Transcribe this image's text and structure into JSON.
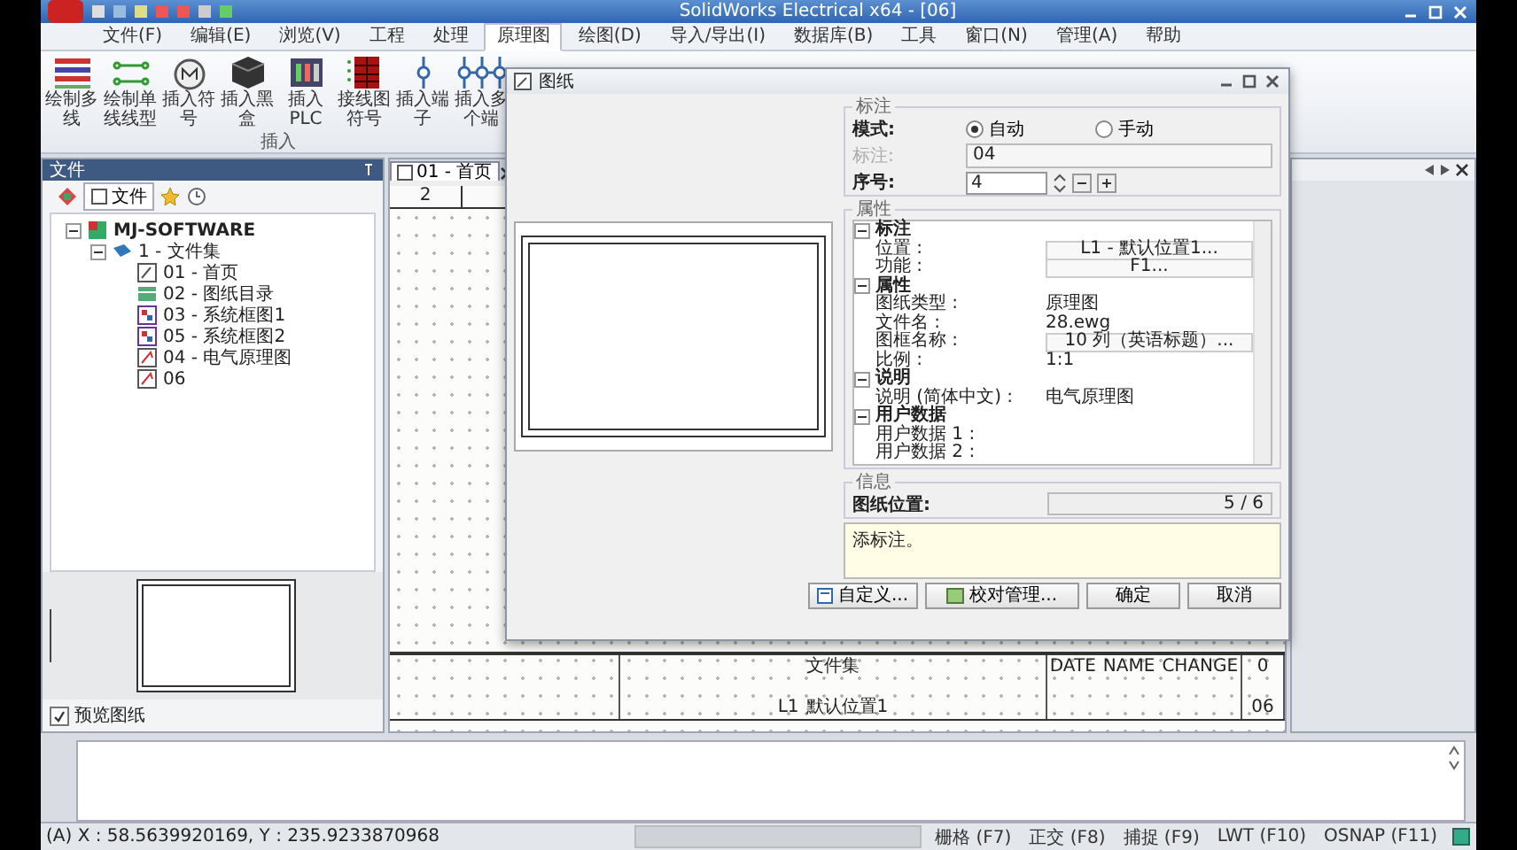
{
  "window": {
    "title": "SolidWorks Electrical x64 - [06]"
  },
  "menu": [
    {
      "label": "文件(F)",
      "selected": false
    },
    {
      "label": "编辑(E)",
      "selected": false
    },
    {
      "label": "浏览(V)",
      "selected": false
    },
    {
      "label": "工程",
      "selected": false
    },
    {
      "label": "处理",
      "selected": false
    },
    {
      "label": "原理图",
      "selected": true
    },
    {
      "label": "绘图(D)",
      "selected": false
    },
    {
      "label": "导入/导出(I)",
      "selected": false
    },
    {
      "label": "数据库(B)",
      "selected": false
    },
    {
      "label": "工具",
      "selected": false
    },
    {
      "label": "窗口(N)",
      "selected": false
    },
    {
      "label": "管理(A)",
      "selected": false
    },
    {
      "label": "帮助",
      "selected": false
    }
  ],
  "ribbon": {
    "group_label": "插入",
    "buttons": [
      {
        "label": "绘制多线",
        "kind": "multiline"
      },
      {
        "label": "绘制单线线型",
        "kind": "wire"
      },
      {
        "label": "插入符号",
        "kind": "symbol"
      },
      {
        "label": "插入黑盒",
        "kind": "blackbox"
      },
      {
        "label": "插入 PLC",
        "kind": "plc"
      },
      {
        "label": "接线图符号",
        "kind": "grid"
      },
      {
        "label": "插入端子",
        "kind": "terminal"
      },
      {
        "label": "插入多个端",
        "kind": "terminals"
      }
    ]
  },
  "file_panel": {
    "title": "文件",
    "tab_label": "文件",
    "tree": [
      {
        "label": "MJ-SOFTWARE",
        "kind": "project",
        "expanded": true,
        "children": [
          {
            "label": "1 - 文件集",
            "kind": "book",
            "expanded": true,
            "children": [
              {
                "label": "01 - 首页",
                "kind": "page"
              },
              {
                "label": "02 - 图纸目录",
                "kind": "list"
              },
              {
                "label": "03 - 系统框图1",
                "kind": "diagram"
              },
              {
                "label": "05 - 系统框图2",
                "kind": "diagram"
              },
              {
                "label": "04 - 电气原理图",
                "kind": "schematic"
              },
              {
                "label": "06",
                "kind": "schematic"
              }
            ]
          }
        ]
      }
    ],
    "preview_checkbox": {
      "label": "预览图纸",
      "checked": true
    }
  },
  "drawing": {
    "tab": "01 - 首页",
    "ruler": [
      "2"
    ],
    "title_block": {
      "title": "文件集",
      "location": "默认位置1",
      "function": "L1",
      "revision": "0",
      "sheet": "06",
      "headers": [
        "DATE",
        "NAME",
        "CHANGE"
      ]
    }
  },
  "dialog": {
    "title": "图纸",
    "annotation": {
      "title": "标注",
      "mode_label": "模式:",
      "modes": [
        {
          "label": "自动",
          "selected": true
        },
        {
          "label": "手动",
          "selected": false
        }
      ],
      "mark_label": "标注:",
      "mark_value": "04",
      "order_label": "序号:",
      "order_value": "4"
    },
    "properties": {
      "title": "属性",
      "categories": [
        {
          "name": "标注",
          "expanded": true,
          "rows": [
            {
              "name": "位置 :",
              "value": "L1 - 默认位置1...",
              "kind": "box"
            },
            {
              "name": "功能 :",
              "value": "F1...",
              "kind": "box"
            }
          ]
        },
        {
          "name": "属性",
          "expanded": true,
          "rows": [
            {
              "name": "图纸类型 :",
              "value": "原理图",
              "kind": "text"
            },
            {
              "name": "文件名 :",
              "value": "28.ewg",
              "kind": "text"
            },
            {
              "name": "图框名称 :",
              "value": "10 列（英语标题）...",
              "kind": "box"
            },
            {
              "name": "比例 :",
              "value": "1:1",
              "kind": "text"
            }
          ]
        },
        {
          "name": "说明",
          "expanded": true,
          "rows": [
            {
              "name": "说明 (简体中文) :",
              "value": "电气原理图",
              "kind": "text"
            }
          ]
        },
        {
          "name": "用户数据",
          "expanded": true,
          "rows": [
            {
              "name": "用户数据 1 :",
              "kind": "text"
            },
            {
              "name": "用户数据 2 :",
              "kind": "text"
            }
          ]
        }
      ]
    },
    "info": {
      "title": "信息",
      "label": "图纸位置:",
      "value": "5 / 6"
    },
    "comment": "添标注。",
    "buttons": [
      {
        "label": "自定义...",
        "kind": "custom"
      },
      {
        "label": "校对管理...",
        "kind": "review"
      },
      {
        "label": "确定",
        "kind": "plain"
      },
      {
        "label": "取消",
        "kind": "plain"
      }
    ]
  },
  "status_bar": {
    "coordinates": "(A) X : 58.5639920169, Y : 235.9233870968",
    "toggles": [
      "栅格 (F7)",
      "正交 (F8)",
      "捕捉 (F9)",
      "LWT (F10)",
      "OSNAP (F11)"
    ]
  }
}
